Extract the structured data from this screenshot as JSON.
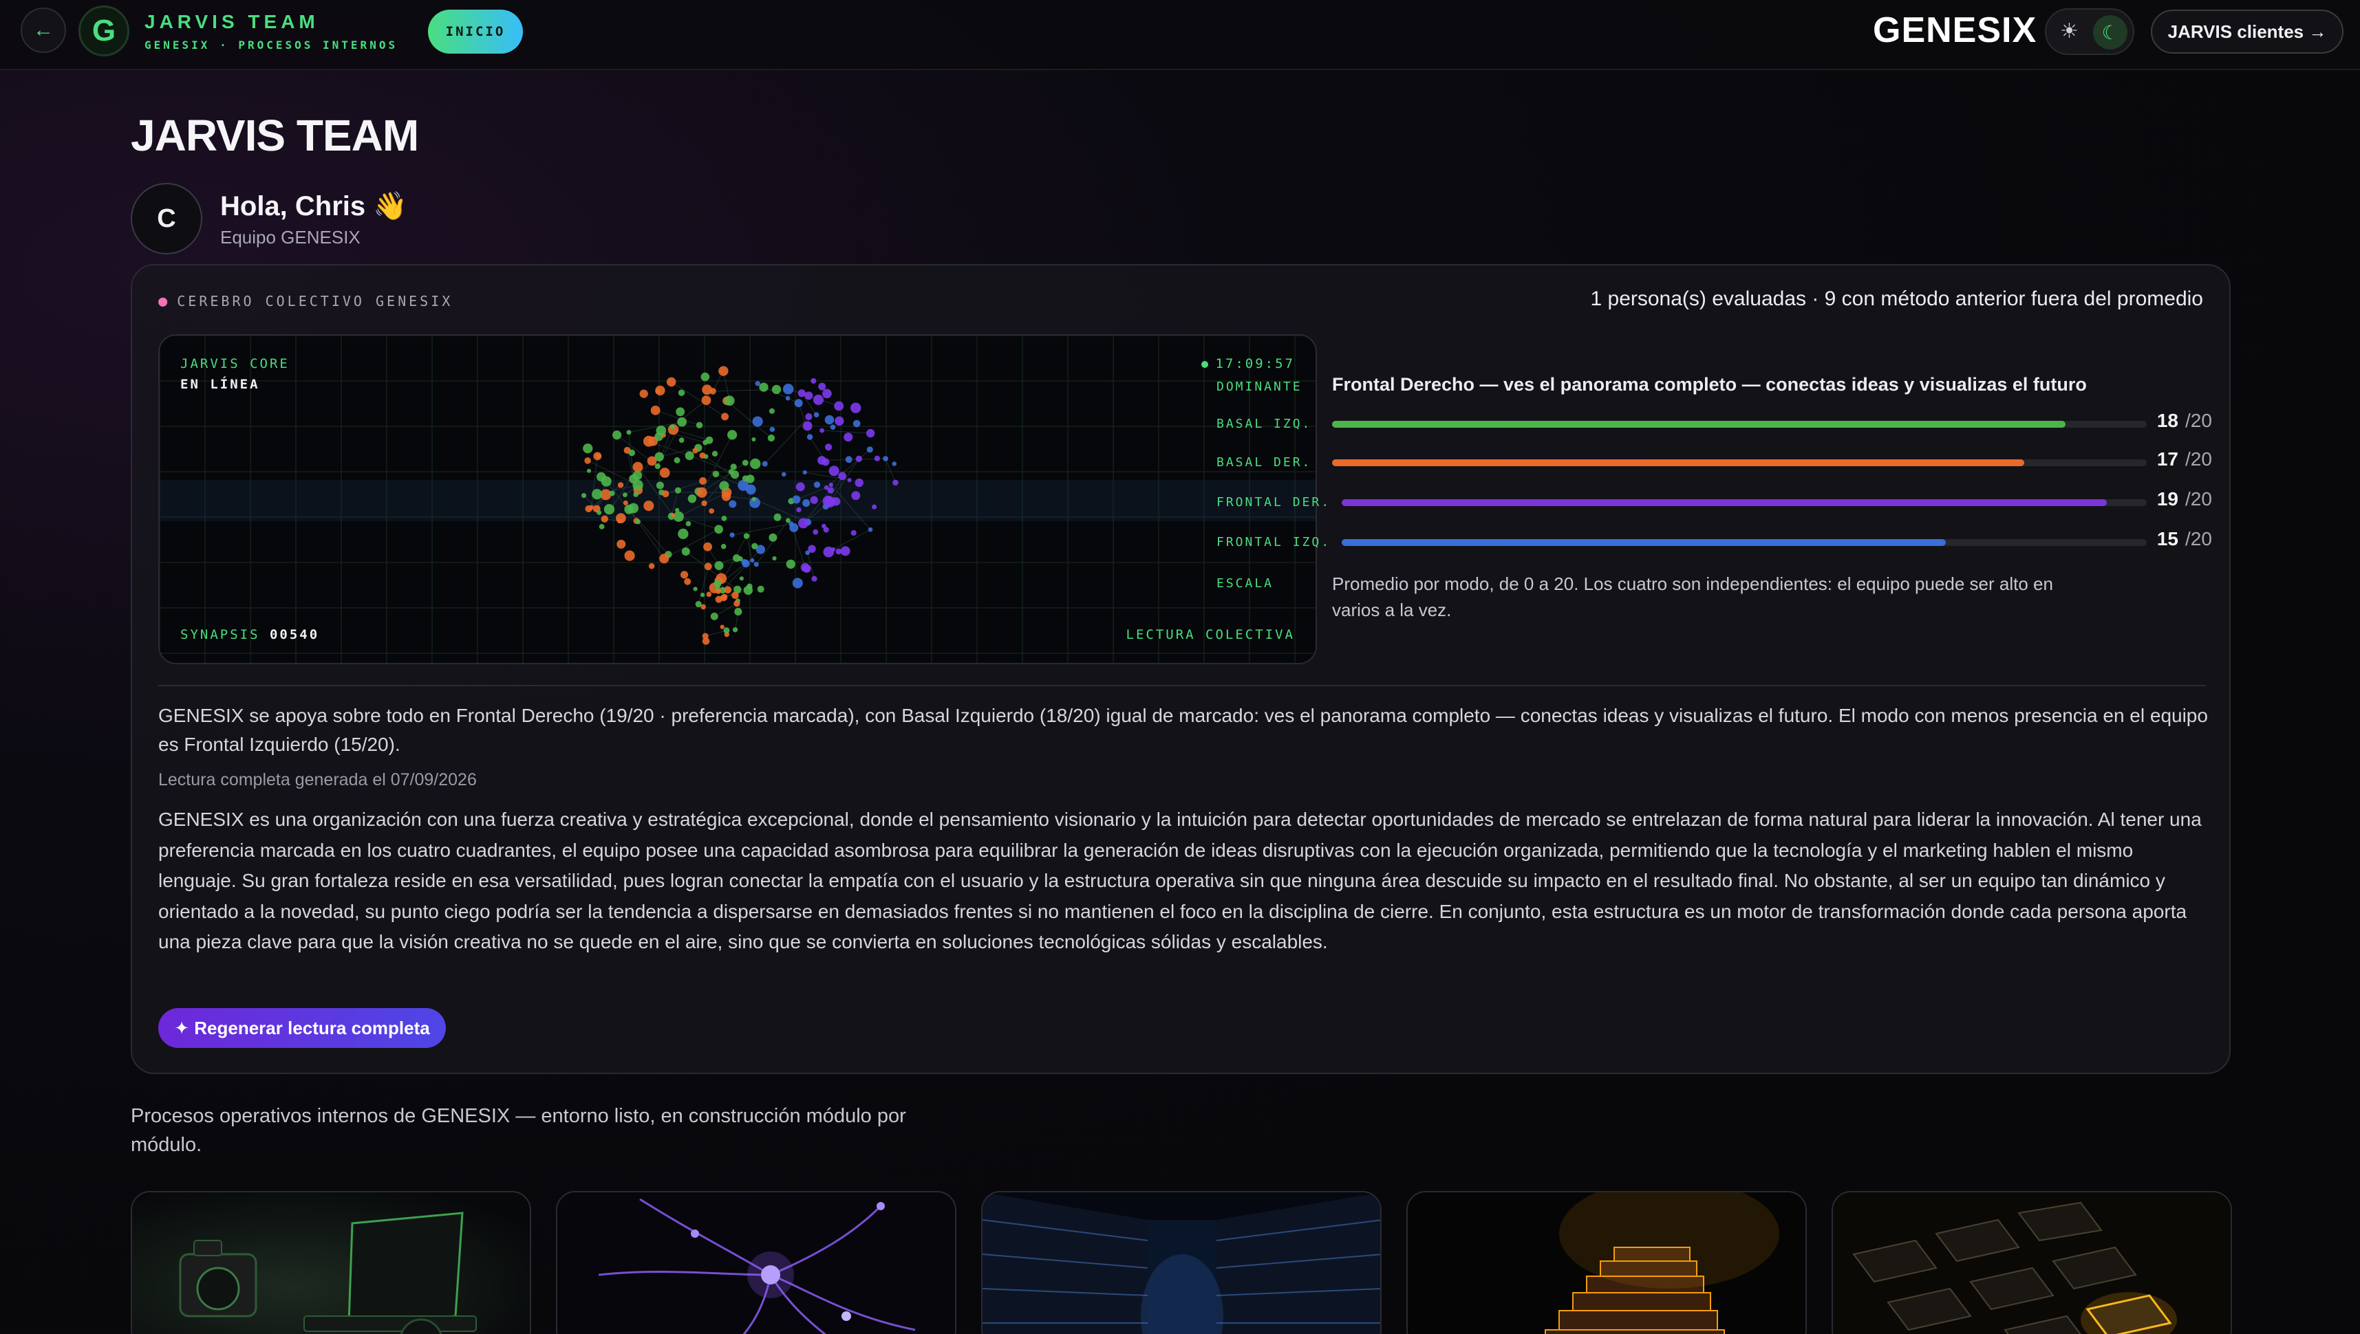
{
  "topbar": {
    "back_icon": "arrow-left-icon",
    "logo_letter": "G",
    "brand_title": "JARVIS TEAM",
    "brand_sub": "GENESIX · PROCESOS INTERNOS",
    "inicio_label": "INICIO",
    "product_name": "GENESIX",
    "theme_light_icon": "sun-icon",
    "theme_dark_icon": "moon-icon",
    "clients_label": "JARVIS clientes →"
  },
  "header": {
    "title": "JARVIS TEAM",
    "avatar_initial": "C",
    "greeting": "Hola, Chris 👋",
    "team": "Equipo GENESIX"
  },
  "brain_card": {
    "kicker": "CEREBRO COLECTIVO GENESIX",
    "kicker_icon": "brain-icon",
    "summary": "1 persona(s) evaluadas · 9 con método anterior fuera del promedio",
    "visual": {
      "core_label": "JARVIS CORE",
      "status": "EN LÍNEA",
      "clock": "17:09:57",
      "synapsis_label": "SYNAPSIS",
      "synapsis_value": "00540",
      "reading_label": "LECTURA COLECTIVA"
    },
    "dominant_label": "DOMINANTE",
    "dominant_text": "Frontal Derecho — ves el panorama completo — conectas ideas y visualizas el futuro",
    "scores": [
      {
        "label": "BASAL IZQ.",
        "value": 18,
        "max": "/20",
        "color": "#4cb54a"
      },
      {
        "label": "BASAL DER.",
        "value": 17,
        "max": "/20",
        "color": "#ea6a2a"
      },
      {
        "label": "FRONTAL DER.",
        "value": 19,
        "max": "/20",
        "color": "#7b35d6"
      },
      {
        "label": "FRONTAL IZQ.",
        "value": 15,
        "max": "/20",
        "color": "#3a6ed8"
      }
    ],
    "scale_label": "ESCALA",
    "scale_text": "Promedio por modo, de 0 a 20. Los cuatro son independientes: el equipo puede ser alto en varios a la vez.",
    "summary_paragraph": "GENESIX se apoya sobre todo en Frontal Derecho (19/20 · preferencia marcada), con Basal Izquierdo (18/20) igual de marcado: ves el panorama completo — conectas ideas y visualizas el futuro. El modo con menos presencia en el equipo es Frontal Izquierdo (15/20).",
    "generated": "Lectura completa generada el 07/09/2026",
    "full_reading": "GENESIX es una organización con una fuerza creativa y estratégica excepcional, donde el pensamiento visionario y la intuición para detectar oportunidades de mercado se entrelazan de forma natural para liderar la innovación. Al tener una preferencia marcada en los cuatro cuadrantes, el equipo posee una capacidad asombrosa para equilibrar la generación de ideas disruptivas con la ejecución organizada, permitiendo que la tecnología y el marketing hablen el mismo lenguaje. Su gran fortaleza reside en esa versatilidad, pues logran conectar la empatía con el usuario y la estructura operativa sin que ninguna área descuide su impacto en el resultado final. No obstante, al ser un equipo tan dinámico y orientado a la novedad, su punto ciego podría ser la tendencia a dispersarse en demasiados frentes si no mantienen el foco en la disciplina de cierre. En conjunto, esta estructura es un motor de transformación donde cada persona aporta una pieza clave para que la visión creativa no se quede en el aire, sino que se convierta en soluciones tecnológicas sólidas y escalables.",
    "regen_label": "✦ Regenerar lectura completa"
  },
  "processes": {
    "intro": "Procesos operativos internos de GENESIX — entorno listo, en construcción módulo por módulo.",
    "tiles": [
      {
        "name": "camera-laptop-image"
      },
      {
        "name": "neural-network-image"
      },
      {
        "name": "server-room-image"
      },
      {
        "name": "stairs-image"
      },
      {
        "name": "glass-grid-image"
      }
    ]
  }
}
